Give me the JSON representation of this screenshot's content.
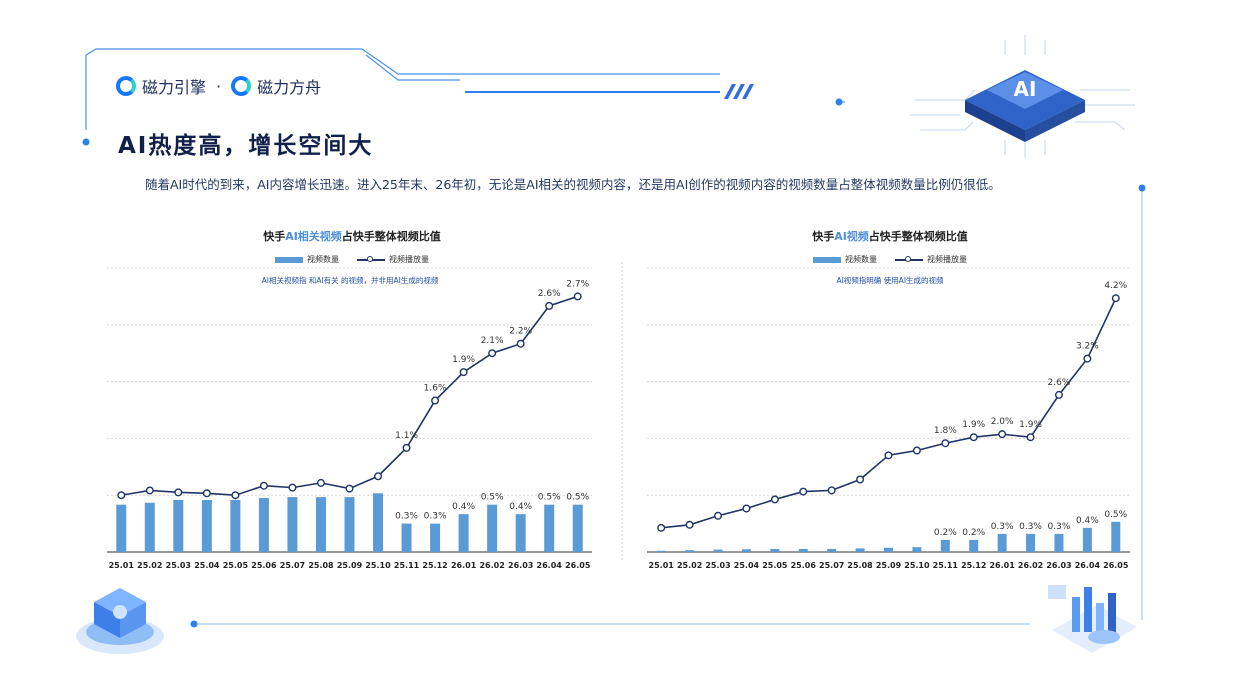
{
  "header": {
    "brand_left": "磁力引擎",
    "brand_sep": "·",
    "brand_right": "磁力方舟",
    "badge_text": "AI"
  },
  "title": "AI热度高，增长空间大",
  "subtitle": "随着AI时代的到来，AI内容增长迅速。进入25年末、26年初，无论是AI相关的视频内容，还是用AI创作的视频内容的视频数量占整体视频数量比例仍很低。",
  "colors": {
    "bar": "#5b9bd5",
    "line": "#1f3565",
    "accent": "#1677ff"
  },
  "chart_data": [
    {
      "type": "bar+line",
      "title_pre": "快手",
      "title_hl": "AI相关视频",
      "title_post": "占快手整体视频比值",
      "note": "AI相关视频指 和AI有关 的视频，并非用AI生成的视频",
      "legend": [
        "视频数量",
        "视频播放量"
      ],
      "categories": [
        "25.01",
        "25.02",
        "25.03",
        "25.04",
        "25.05",
        "25.06",
        "25.07",
        "25.08",
        "25.09",
        "25.10",
        "25.11",
        "25.12",
        "26.01",
        "26.02",
        "26.03",
        "26.04",
        "26.05"
      ],
      "series": [
        {
          "name": "视频数量",
          "kind": "bar",
          "values": [
            0.5,
            0.52,
            0.55,
            0.55,
            0.55,
            0.57,
            0.58,
            0.58,
            0.58,
            0.62,
            0.3,
            0.3,
            0.4,
            0.5,
            0.4,
            0.5,
            0.5
          ],
          "labels": [
            "",
            "",
            "",
            "",
            "",
            "",
            "",
            "",
            "",
            "",
            "0.3%",
            "0.3%",
            "0.4%",
            "0.5%",
            "0.4%",
            "0.5%",
            "0.5%"
          ]
        },
        {
          "name": "视频播放量",
          "kind": "line",
          "values": [
            0.6,
            0.65,
            0.63,
            0.62,
            0.6,
            0.7,
            0.68,
            0.73,
            0.67,
            0.8,
            1.1,
            1.6,
            1.9,
            2.1,
            2.2,
            2.6,
            2.7
          ],
          "labels": [
            "",
            "",
            "",
            "",
            "",
            "",
            "",
            "",
            "",
            "",
            "1.1%",
            "1.6%",
            "1.9%",
            "2.1%",
            "2.2%",
            "2.6%",
            "2.7%"
          ]
        }
      ],
      "grid": true
    },
    {
      "type": "bar+line",
      "title_pre": "快手",
      "title_hl": "AI视频",
      "title_post": "占快手整体视频比值",
      "note": "AI视频指明确 使用AI生成的视频",
      "legend": [
        "视频数量",
        "视频播放量"
      ],
      "categories": [
        "25.01",
        "25.02",
        "25.03",
        "25.04",
        "25.05",
        "25.06",
        "25.07",
        "25.08",
        "25.09",
        "25.10",
        "25.11",
        "25.12",
        "26.01",
        "26.02",
        "26.03",
        "26.04",
        "26.05"
      ],
      "series": [
        {
          "name": "视频数量",
          "kind": "bar",
          "values": [
            0.02,
            0.03,
            0.04,
            0.045,
            0.05,
            0.05,
            0.05,
            0.06,
            0.07,
            0.08,
            0.2,
            0.2,
            0.3,
            0.3,
            0.3,
            0.4,
            0.5
          ],
          "labels": [
            "",
            "",
            "",
            "",
            "",
            "",
            "",
            "",
            "",
            "",
            "0.2%",
            "0.2%",
            "0.3%",
            "0.3%",
            "0.3%",
            "0.4%",
            "0.5%"
          ]
        },
        {
          "name": "视频播放量",
          "kind": "line",
          "values": [
            0.4,
            0.45,
            0.6,
            0.72,
            0.87,
            1.0,
            1.02,
            1.2,
            1.6,
            1.68,
            1.8,
            1.9,
            1.95,
            1.9,
            2.6,
            3.2,
            4.2
          ],
          "labels": [
            "",
            "",
            "",
            "",
            "",
            "",
            "",
            "",
            "",
            "",
            "1.8%",
            "1.9%",
            "2.0%",
            "1.9%",
            "2.6%",
            "3.2%",
            "4.2%"
          ]
        }
      ],
      "grid": true
    }
  ]
}
